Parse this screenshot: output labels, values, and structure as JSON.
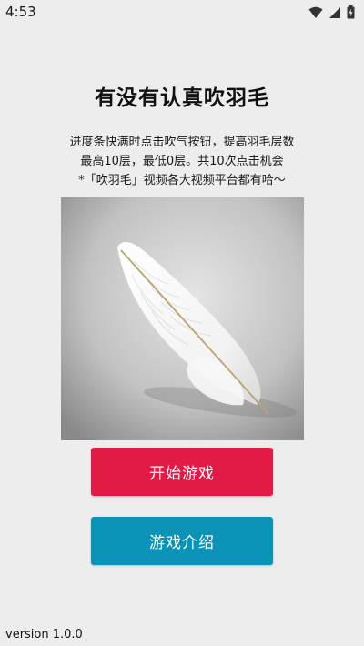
{
  "status_bar": {
    "time": "4:53",
    "icons": [
      "wifi-icon",
      "signal-icon",
      "battery-charging-icon"
    ]
  },
  "title": "有没有认真吹羽毛",
  "description": {
    "line1": "进度条快满时点击吹气按钮，提高羽毛层数",
    "line2": "最高10层，最低0层。共10次点击机会",
    "line3": "*「吹羽毛」视频各大视频平台都有哈～"
  },
  "image": {
    "subject": "white-feather-image"
  },
  "buttons": {
    "start_label": "开始游戏",
    "intro_label": "游戏介绍"
  },
  "colors": {
    "start_button": "#e11b46",
    "intro_button": "#0a93b7",
    "background": "#ededed"
  },
  "version": "version 1.0.0"
}
